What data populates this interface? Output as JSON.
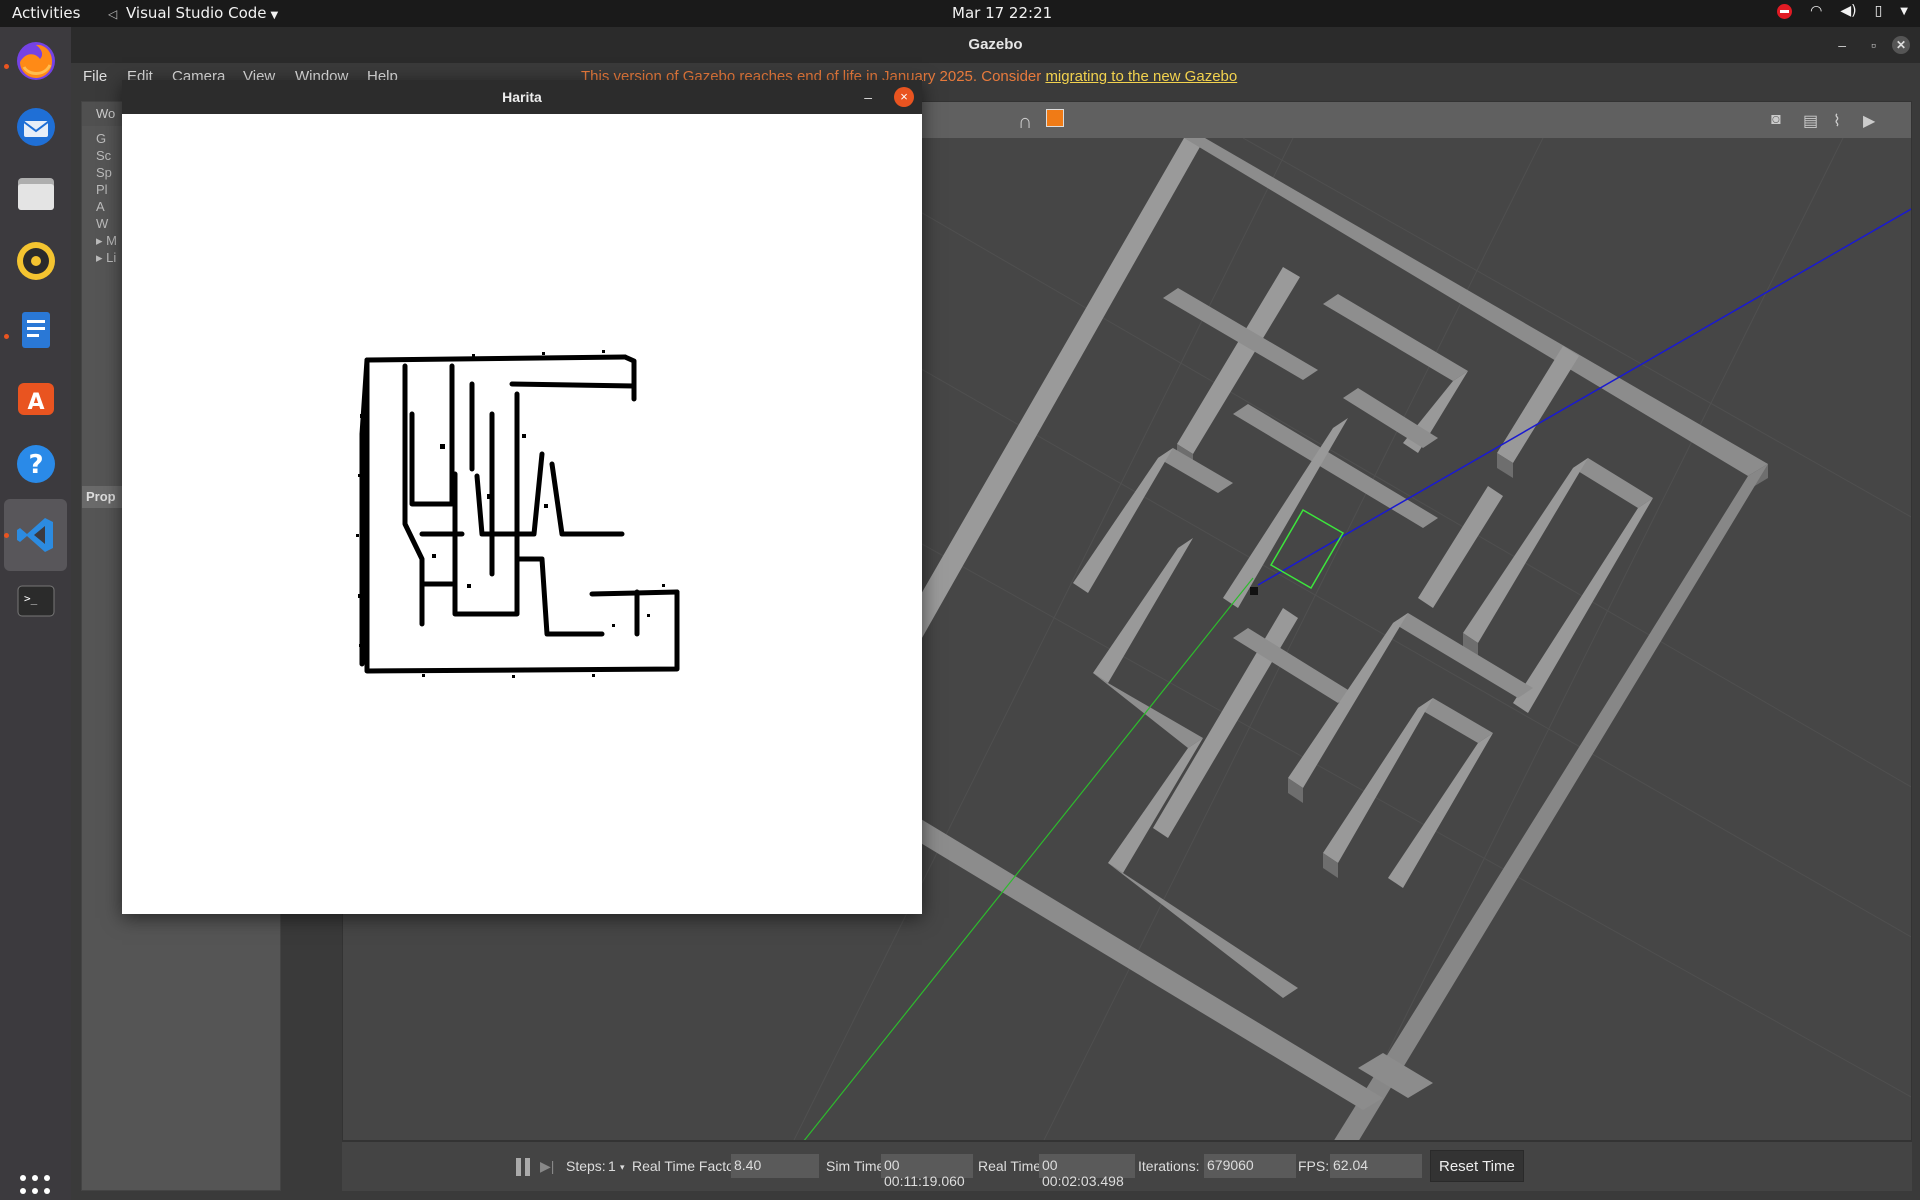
{
  "topbar": {
    "activities": "Activities",
    "app_name": "Visual Studio Code",
    "clock": "Mar 17  22:21"
  },
  "dock": {
    "items": [
      "firefox-icon",
      "thunderbird-icon",
      "files-icon",
      "rhythmbox-icon",
      "writer-icon",
      "app-center-icon",
      "help-icon",
      "vscode-icon",
      "terminal-icon"
    ],
    "show_apps": "show-apps-icon"
  },
  "gazebo": {
    "title": "Gazebo",
    "menu": {
      "file": "File",
      "edit": "Edit",
      "camera": "Camera",
      "view": "View",
      "window": "Window",
      "help": "Help"
    },
    "notice_text": "This version of Gazebo reaches end of life in January 2025. Consider ",
    "notice_link": "migrating to the new Gazebo",
    "left_panel": {
      "header": "Wo",
      "tree": [
        "G",
        "Sc",
        "Sp",
        "Pl",
        "A",
        "W",
        "M",
        "Li"
      ],
      "properties": "Prop"
    },
    "bottom": {
      "steps_label": "Steps:",
      "steps_value": "1",
      "rtf_label": "Real Time Factor:",
      "rtf_value": "8.40",
      "sim_label": "Sim Time:",
      "sim_value": "00 00:11:19.060",
      "real_label": "Real Time:",
      "real_value": "00 00:02:03.498",
      "iter_label": "Iterations:",
      "iter_value": "679060",
      "fps_label": "FPS:",
      "fps_value": "62.04",
      "reset": "Reset Time"
    }
  },
  "harita": {
    "title": "Harita",
    "minimize": "–",
    "close": "×"
  },
  "colors": {
    "ubuntu_orange": "#e95420",
    "maze_wall": "#8c8c8c",
    "ray": "#1a1ad0",
    "path": "#2dbb2d"
  }
}
